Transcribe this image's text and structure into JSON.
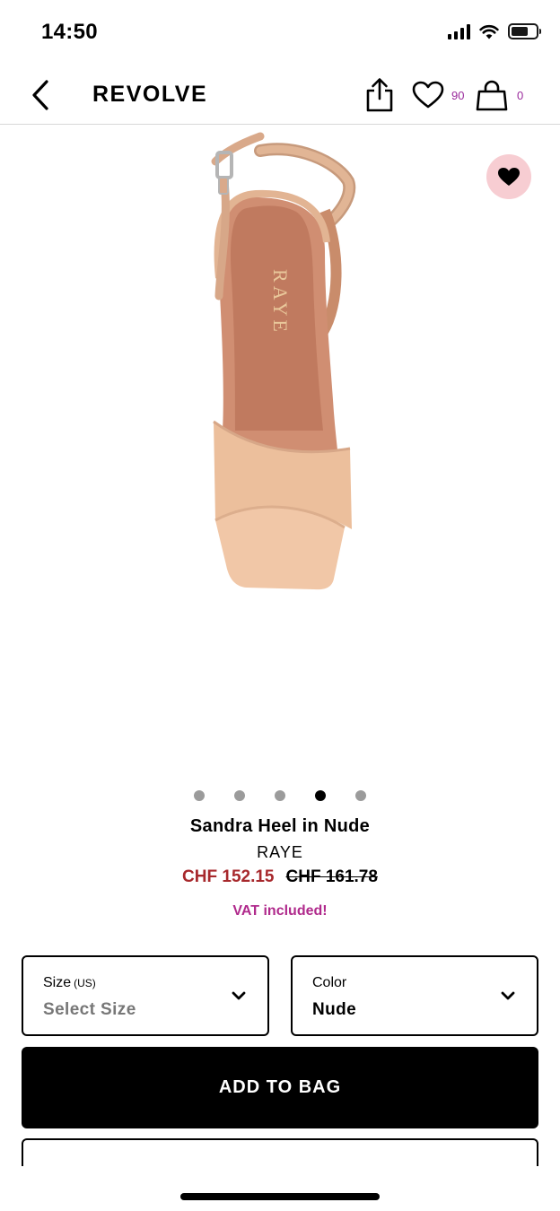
{
  "status_bar": {
    "time": "14:50",
    "icons": [
      "signal-icon",
      "wifi-icon",
      "battery-icon"
    ],
    "battery_level": 0.7
  },
  "nav": {
    "back_icon": "chevron-left-icon",
    "brand": "REVOLVE",
    "share_icon": "share-icon",
    "wishlist_icon": "heart-outline-icon",
    "wishlist_count": "90",
    "bag_icon": "shopping-bag-icon",
    "bag_count": "0",
    "count_color": "#9a2a9c"
  },
  "product": {
    "image_alt": "sandal-image",
    "image_brand_mark": "RAYE",
    "favorite_icon": "heart-filled-icon",
    "favorite_bg": "#f7cdd2",
    "carousel": {
      "total": 5,
      "active_index": 3
    },
    "name": "Sandra Heel in Nude",
    "brand": "RAYE",
    "price_sale": "CHF 152.15",
    "price_original": "CHF 161.78",
    "price_sale_color": "#a7282c",
    "vat_note": "VAT included!",
    "vat_color": "#b02a8c"
  },
  "size_select": {
    "label": "Size",
    "unit": "(US)",
    "value": "Select Size",
    "icon": "chevron-down-icon"
  },
  "color_select": {
    "label": "Color",
    "value": "Nude",
    "icon": "chevron-down-icon"
  },
  "add_to_bag_label": "ADD TO BAG"
}
